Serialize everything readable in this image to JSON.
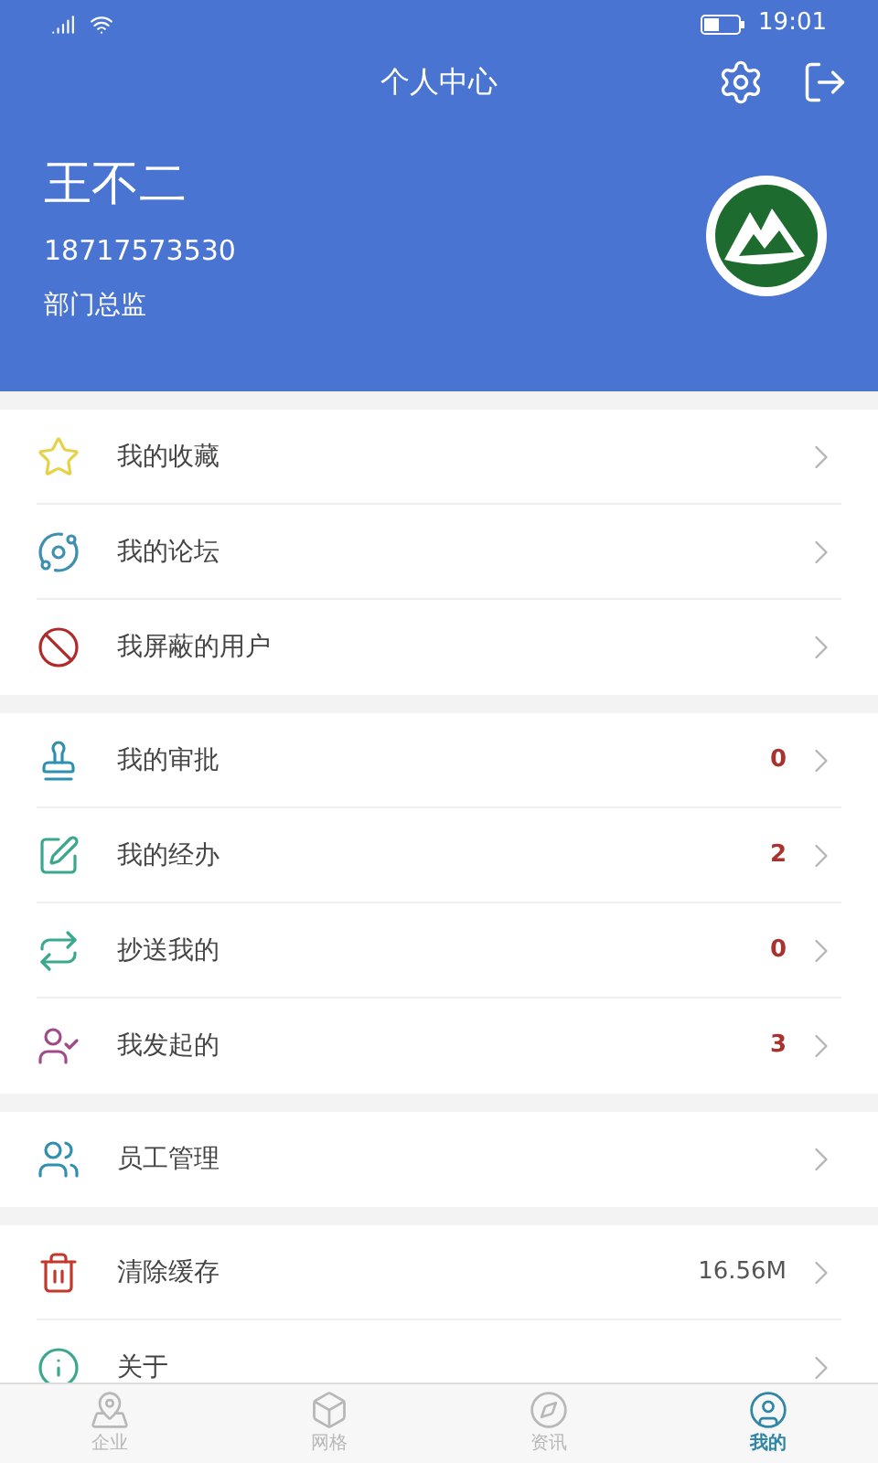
{
  "status_bar": {
    "time": "19:01"
  },
  "header": {
    "title": "个人中心"
  },
  "profile": {
    "name": "王不二",
    "phone": "18717573530",
    "role": "部门总监"
  },
  "groups": [
    {
      "rows": [
        {
          "label": "我的收藏",
          "kind": "plain"
        },
        {
          "label": "我的论坛",
          "kind": "plain"
        },
        {
          "label": "我屏蔽的用户",
          "kind": "plain"
        }
      ]
    },
    {
      "rows": [
        {
          "label": "我的审批",
          "kind": "count",
          "value": "0"
        },
        {
          "label": "我的经办",
          "kind": "count",
          "value": "2"
        },
        {
          "label": "抄送我的",
          "kind": "count",
          "value": "0"
        },
        {
          "label": "我发起的",
          "kind": "count",
          "value": "3"
        }
      ]
    },
    {
      "rows": [
        {
          "label": "员工管理",
          "kind": "plain"
        }
      ]
    },
    {
      "rows": [
        {
          "label": "清除缓存",
          "kind": "info",
          "value": "16.56M"
        },
        {
          "label": "关于",
          "kind": "plain"
        }
      ]
    }
  ],
  "nav": [
    {
      "label": "企业",
      "selected": false
    },
    {
      "label": "网格",
      "selected": false
    },
    {
      "label": "资讯",
      "selected": false
    },
    {
      "label": "我的",
      "selected": true
    }
  ]
}
